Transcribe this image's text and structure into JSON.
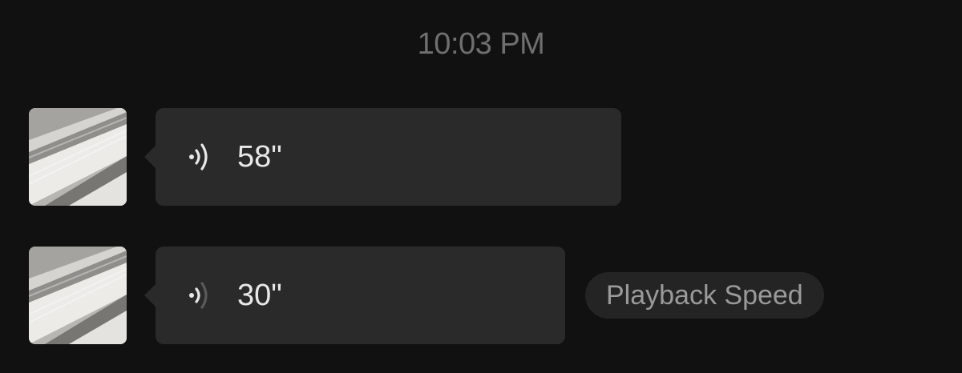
{
  "timestamp": "10:03 PM",
  "messages": [
    {
      "duration": "58\"",
      "playing": false
    },
    {
      "duration": "30\"",
      "playing": true
    }
  ],
  "playback_speed_label": "Playback Speed",
  "icons": {
    "avatar": "avatar-image",
    "voice": "voice-wave-icon"
  },
  "colors": {
    "background": "#111111",
    "bubble": "#2a2a2a",
    "text": "#e8e8e8",
    "muted": "#6f6f6f"
  }
}
